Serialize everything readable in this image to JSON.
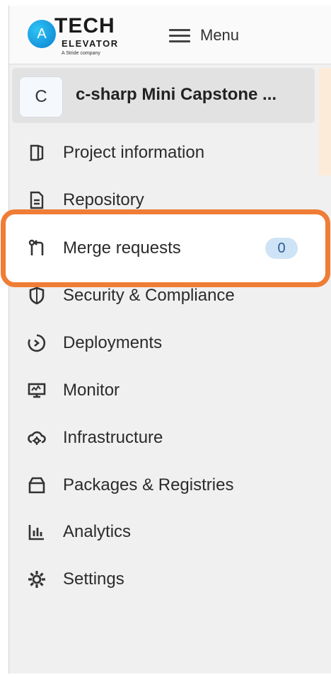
{
  "brand": {
    "logo_letter": "A",
    "logo_tech": "TECH",
    "logo_elevator": "ELEVATOR",
    "logo_tagline": "A Stride company"
  },
  "topbar": {
    "menu_label": "Menu"
  },
  "project": {
    "avatar_letter": "C",
    "name": "c-sharp Mini Capstone ..."
  },
  "nav": {
    "items": [
      {
        "label": "Project information",
        "icon": "project-information-icon"
      },
      {
        "label": "Repository",
        "icon": "repository-icon"
      },
      {
        "label": "Merge requests",
        "icon": "merge-request-icon",
        "badge": "0"
      },
      {
        "label": "Security & Compliance",
        "icon": "shield-icon"
      },
      {
        "label": "Deployments",
        "icon": "deployments-icon"
      },
      {
        "label": "Monitor",
        "icon": "monitor-icon"
      },
      {
        "label": "Infrastructure",
        "icon": "cloud-gear-icon"
      },
      {
        "label": "Packages & Registries",
        "icon": "package-icon"
      },
      {
        "label": "Analytics",
        "icon": "analytics-icon"
      },
      {
        "label": "Settings",
        "icon": "gear-icon"
      }
    ]
  },
  "colors": {
    "highlight": "#ef7d35",
    "badge_bg": "#cfe3f7",
    "badge_text": "#2b5d91",
    "logo_blue": "#0a7fd0"
  }
}
